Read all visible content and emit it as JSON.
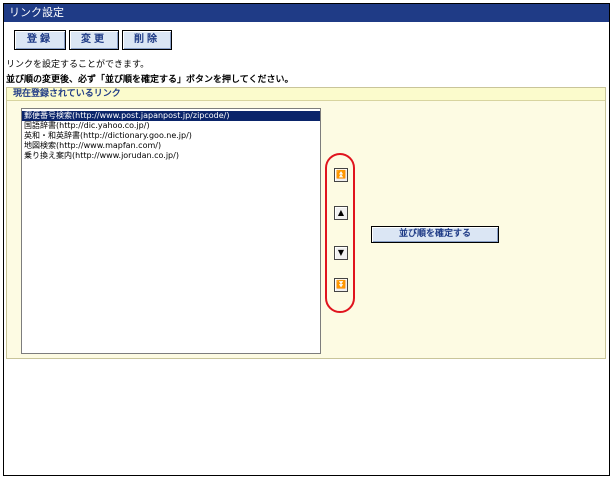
{
  "window": {
    "title": "リンク設定"
  },
  "toolbar": {
    "register_label": "登録",
    "change_label": "変更",
    "delete_label": "削除"
  },
  "notices": {
    "line1": "リンクを設定することができます。",
    "line2": "並び順の変更後、必ず「並び順を確定する」ボタンを押してください。"
  },
  "panel": {
    "header": "現在登録されているリンク",
    "links": [
      "郵便番号検索(http://www.post.japanpost.jp/zipcode/)",
      "国語辞書(http://dic.yahoo.co.jp/)",
      "英和・和英辞書(http://dictionary.goo.ne.jp/)",
      "地図検索(http://www.mapfan.com/)",
      "乗り換え案内(http://www.jorudan.co.jp/)"
    ],
    "selected_index": 0,
    "confirm_label": "並び順を確定する"
  },
  "sort_buttons": {
    "top_glyph": "⏫",
    "up_glyph": "▲",
    "down_glyph": "▼",
    "bottom_glyph": "⏬"
  },
  "colors": {
    "titlebar": "#1f3b86",
    "panel_bg": "#fdfbe3",
    "highlight_ring": "#e0141e",
    "selection": "#0a246a"
  }
}
